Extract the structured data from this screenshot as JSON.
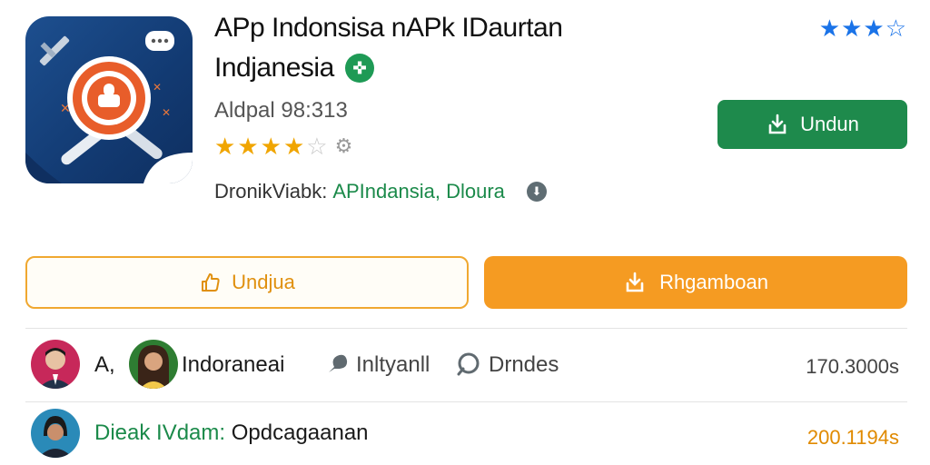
{
  "app": {
    "title_line1": "APp Indonsisa nAPk IDaurtan",
    "title_line2": "Indjanesia",
    "subtitle": "Aldpal 98:313",
    "rating_stars": {
      "full": 4,
      "empty": 1
    },
    "developer_label": "DronikViabk:",
    "developer_name": "APIndansia, Dloura",
    "verified_icon": "verified-check-icon"
  },
  "top_rating": {
    "full": 3,
    "empty": 1
  },
  "buttons": {
    "install_label": "Undun",
    "outline_label": "Undjua",
    "orange_label": "Rhgamboan"
  },
  "rows": [
    {
      "prefix": "A,",
      "name": "Indoraneai",
      "action1": "Inltyanll",
      "action2": "Drndes",
      "value": "170.3000s"
    },
    {
      "label": "Dieak IVdam:",
      "name": "Opdcagaanan",
      "value": "200.1194s"
    }
  ],
  "colors": {
    "green": "#1e8a4c",
    "orange": "#f59b22",
    "blue_star": "#1a73e8",
    "gold_star": "#f0a500",
    "link_green": "#1b8a4a",
    "value_orange": "#e08a00"
  }
}
